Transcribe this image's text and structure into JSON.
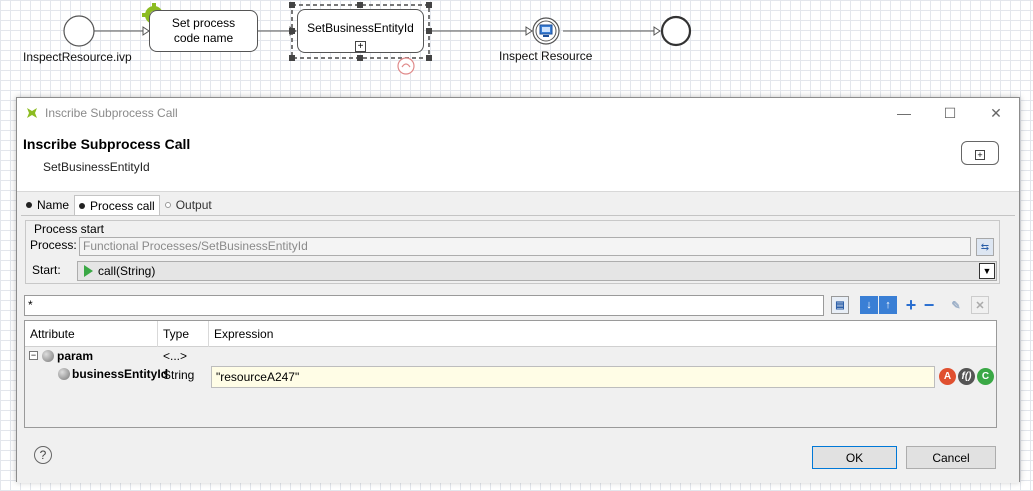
{
  "diagram": {
    "start_label": "InspectResource.ivp",
    "task1_label_line1": "Set process",
    "task1_label_line2": "code name",
    "subprocess_label": "SetBusinessEntityId",
    "user_task_label": "Inspect Resource"
  },
  "dialog": {
    "window_title": "Inscribe Subprocess Call",
    "header_title": "Inscribe Subprocess Call",
    "header_subtitle": "SetBusinessEntityId",
    "window_buttons": {
      "minimize": "—",
      "maximize": "☐",
      "close": "✕"
    },
    "tabs": [
      {
        "label": "Name"
      },
      {
        "label": "Process call"
      },
      {
        "label": "Output"
      }
    ],
    "process_start": {
      "group_title": "Process start",
      "process_label": "Process:",
      "process_value": "Functional Processes/SetBusinessEntityId",
      "start_label": "Start:",
      "start_value": "call(String)"
    },
    "filter_value": "*",
    "table": {
      "columns": [
        "Attribute",
        "Type",
        "Expression"
      ],
      "rows": [
        {
          "attribute": "param",
          "type": "<...>",
          "expression": ""
        },
        {
          "attribute": "businessEntityId",
          "type": "String",
          "expression": "\"resourceA247\""
        }
      ]
    },
    "footer": {
      "help": "?",
      "ok_label": "OK",
      "cancel_label": "Cancel"
    }
  },
  "colors": {
    "accent": "#0078d7",
    "expression_bg": "#fffde6",
    "start_play": "#3aa845"
  }
}
